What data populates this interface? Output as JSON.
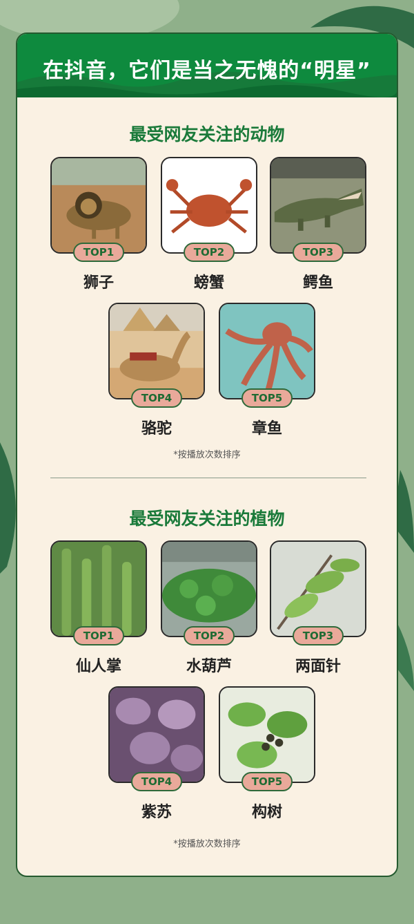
{
  "header": {
    "title": "在抖音，它们是当之无愧的“明星”"
  },
  "animals": {
    "title": "最受网友关注的动物",
    "note": "*按播放次数排序",
    "items": [
      {
        "rank": "TOP1",
        "name": "狮子",
        "icon": "lion-photo"
      },
      {
        "rank": "TOP2",
        "name": "螃蟹",
        "icon": "crab-photo"
      },
      {
        "rank": "TOP3",
        "name": "鳄鱼",
        "icon": "crocodile-photo"
      },
      {
        "rank": "TOP4",
        "name": "骆驼",
        "icon": "camel-photo"
      },
      {
        "rank": "TOP5",
        "name": "章鱼",
        "icon": "octopus-photo"
      }
    ]
  },
  "plants": {
    "title": "最受网友关注的植物",
    "note": "*按播放次数排序",
    "items": [
      {
        "rank": "TOP1",
        "name": "仙人掌",
        "icon": "cactus-photo"
      },
      {
        "rank": "TOP2",
        "name": "水葫芦",
        "icon": "water-hyacinth-photo"
      },
      {
        "rank": "TOP3",
        "name": "两面针",
        "icon": "zanthoxylum-photo"
      },
      {
        "rank": "TOP4",
        "name": "紫苏",
        "icon": "perilla-photo"
      },
      {
        "rank": "TOP5",
        "name": "构树",
        "icon": "paper-mulberry-photo"
      }
    ]
  },
  "colors": {
    "background": "#8fb08a",
    "card": "#faf1e3",
    "header": "#0e8a3e",
    "accent": "#1a7a3a",
    "badge": "#e9a99a"
  }
}
